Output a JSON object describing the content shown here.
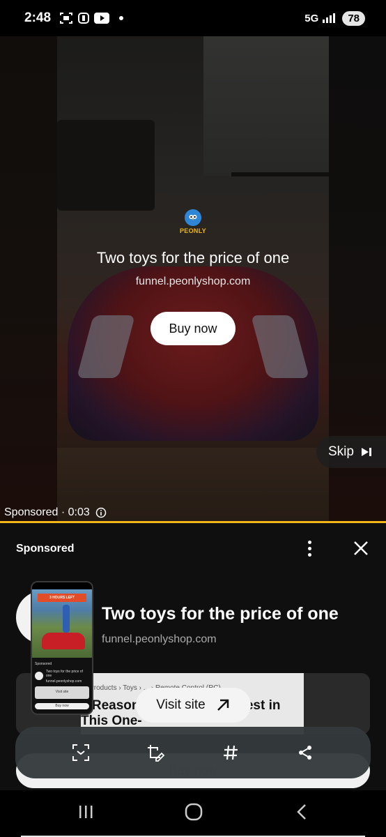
{
  "status_bar": {
    "time": "2:48",
    "network": "5G",
    "battery": "78"
  },
  "video_ad": {
    "brand_logo_text": "PEONLY",
    "title": "Two toys for the price of one",
    "url": "funnel.peonlyshop.com",
    "cta_label": "Buy now",
    "skip_label": "Skip",
    "sponsored_timer": "Sponsored · 0:03"
  },
  "panel": {
    "sponsored_label": "Sponsored",
    "title": "Two toys for the price of one",
    "url": "funnel.peonlyshop.com",
    "article_breadcrumb": "› Products › Toys › ... › Remote Control (RC)",
    "article_headline": "5 Reasons You Should Invest in This One-",
    "visit_site_label": "Visit site",
    "buy_now_label": "Buy now"
  },
  "thumbnail": {
    "banner": "3 HOURS LEFT",
    "sponsored": "Sponsored",
    "title": "Two toys for the price of one",
    "url": "funnel.peonlyshop.com",
    "visit_site": "Visit site",
    "buy_now": "Buy now"
  },
  "toolbar_icons": [
    "scan-text-icon",
    "edit-crop-icon",
    "hashtag-icon",
    "share-icon"
  ],
  "colors": {
    "progress": "#f3b619",
    "logo_blue": "#2f86d6",
    "logo_yellow": "#f2b705"
  }
}
